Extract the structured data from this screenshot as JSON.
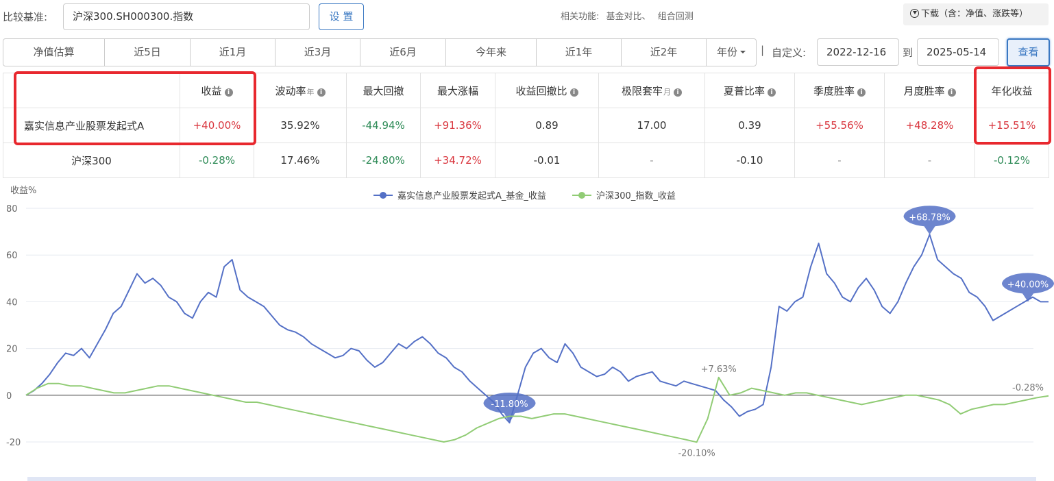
{
  "toolbar": {
    "base_label": "比较基准:",
    "base_value": "沪深300.SH000300.指数",
    "set_button": "设 置",
    "related_label": "相关功能:",
    "related_links": [
      "基金对比、",
      "组合回测"
    ],
    "download": "下载（含：净值、涨跌等）"
  },
  "periods": {
    "tabs": [
      "净值估算",
      "近5日",
      "近1月",
      "近3月",
      "近6月",
      "今年来",
      "近1年",
      "近2年",
      "年份"
    ],
    "separator": "|",
    "custom_label": "自定义:",
    "start_date": "2022-12-16",
    "to_label": "到",
    "end_date": "2025-05-14",
    "view_button": "查看"
  },
  "stats": {
    "headers": [
      {
        "label": "收益",
        "unit": "",
        "info": true
      },
      {
        "label": "波动率",
        "unit": "年",
        "info": true
      },
      {
        "label": "最大回撤",
        "unit": "",
        "info": false
      },
      {
        "label": "最大涨幅",
        "unit": "",
        "info": false
      },
      {
        "label": "收益回撤比",
        "unit": "",
        "info": true
      },
      {
        "label": "极限套牢",
        "unit": "月",
        "info": true
      },
      {
        "label": "夏普比率",
        "unit": "",
        "info": true
      },
      {
        "label": "季度胜率",
        "unit": "",
        "info": true
      },
      {
        "label": "月度胜率",
        "unit": "",
        "info": true
      },
      {
        "label": "年化收益",
        "unit": "",
        "info": false
      }
    ],
    "rows": [
      {
        "name": "嘉实信息产业股票发起式A",
        "cells": [
          {
            "v": "+40.00%",
            "c": "red"
          },
          {
            "v": "35.92%",
            "c": ""
          },
          {
            "v": "-44.94%",
            "c": "green"
          },
          {
            "v": "+91.36%",
            "c": "red"
          },
          {
            "v": "0.89",
            "c": ""
          },
          {
            "v": "17.00",
            "c": ""
          },
          {
            "v": "0.39",
            "c": ""
          },
          {
            "v": "+55.56%",
            "c": "red"
          },
          {
            "v": "+48.28%",
            "c": "red"
          },
          {
            "v": "+15.51%",
            "c": "red"
          }
        ]
      },
      {
        "name": "沪深300",
        "cells": [
          {
            "v": "-0.28%",
            "c": "green"
          },
          {
            "v": "17.46%",
            "c": ""
          },
          {
            "v": "-24.80%",
            "c": "green"
          },
          {
            "v": "+34.72%",
            "c": "red"
          },
          {
            "v": "-0.01",
            "c": ""
          },
          {
            "v": "-",
            "c": "grey"
          },
          {
            "v": "-0.10",
            "c": ""
          },
          {
            "v": "-",
            "c": "grey"
          },
          {
            "v": "-",
            "c": "grey"
          },
          {
            "v": "-0.12%",
            "c": "green"
          }
        ]
      }
    ]
  },
  "colors": {
    "fund_line": "#5470c6",
    "index_line": "#91cc75",
    "up": "#d9363e",
    "down": "#2e8b57",
    "highlight": "#e8282e",
    "accent": "#3a78c2"
  },
  "chart_data": {
    "type": "line",
    "ylabel": "收益%",
    "ylim": [
      -20,
      80
    ],
    "yticks": [
      -20,
      0,
      20,
      40,
      60,
      80
    ],
    "grid": true,
    "legend_position": "top-center",
    "series": [
      {
        "name": "嘉实信息产业股票发起式A_基金_收益",
        "color": "#5470c6",
        "values": [
          0,
          2,
          5,
          9,
          14,
          18,
          17,
          20,
          16,
          22,
          28,
          35,
          38,
          45,
          52,
          48,
          50,
          47,
          42,
          40,
          35,
          33,
          40,
          44,
          42,
          55,
          58,
          45,
          42,
          40,
          38,
          34,
          30,
          28,
          27,
          25,
          22,
          20,
          18,
          16,
          17,
          20,
          19,
          15,
          12,
          14,
          18,
          22,
          20,
          23,
          25,
          22,
          18,
          16,
          12,
          10,
          6,
          3,
          0,
          -3,
          -8,
          -11.8,
          0,
          12,
          18,
          20,
          16,
          14,
          22,
          18,
          12,
          10,
          8,
          9,
          12,
          10,
          6,
          8,
          9,
          10,
          6,
          5,
          4,
          6,
          5,
          4,
          3,
          2,
          -2,
          -5,
          -9,
          -7,
          -6,
          -4,
          12,
          38,
          36,
          40,
          42,
          55,
          65,
          52,
          48,
          42,
          40,
          46,
          50,
          45,
          38,
          35,
          40,
          48,
          55,
          60,
          68.78,
          58,
          55,
          52,
          50,
          44,
          42,
          38,
          32,
          34,
          36,
          38,
          40,
          42,
          40,
          40
        ],
        "annotations": [
          {
            "label": "+68.78%",
            "type": "max"
          },
          {
            "label": "-11.80%",
            "type": "min"
          },
          {
            "label": "+40.00%",
            "type": "last"
          }
        ]
      },
      {
        "name": "沪深300_指数_收益",
        "color": "#91cc75",
        "values": [
          0,
          3,
          5,
          5,
          4,
          4,
          3,
          2,
          1,
          1,
          2,
          3,
          4,
          4,
          3,
          2,
          1,
          0,
          -1,
          -2,
          -3,
          -3,
          -4,
          -5,
          -6,
          -7,
          -8,
          -9,
          -10,
          -11,
          -12,
          -13,
          -14,
          -15,
          -16,
          -17,
          -18,
          -19,
          -20,
          -19,
          -17,
          -14,
          -12,
          -10,
          -9,
          -9,
          -10,
          -9,
          -8,
          -8,
          -9,
          -10,
          -11,
          -12,
          -13,
          -14,
          -15,
          -16,
          -17,
          -18,
          -19,
          -20.1,
          -10,
          7.63,
          0,
          1,
          3,
          2,
          1,
          0,
          1,
          1,
          0,
          -1,
          -2,
          -3,
          -4,
          -3,
          -2,
          -1,
          0,
          0,
          -1,
          -2,
          -4,
          -8,
          -6,
          -5,
          -4,
          -4,
          -3,
          -2,
          -1,
          -0.28
        ],
        "annotations": [
          {
            "label": "+7.63%",
            "type": "max"
          },
          {
            "label": "-20.10%",
            "type": "min"
          },
          {
            "label": "-0.28%",
            "type": "last"
          }
        ]
      }
    ]
  }
}
